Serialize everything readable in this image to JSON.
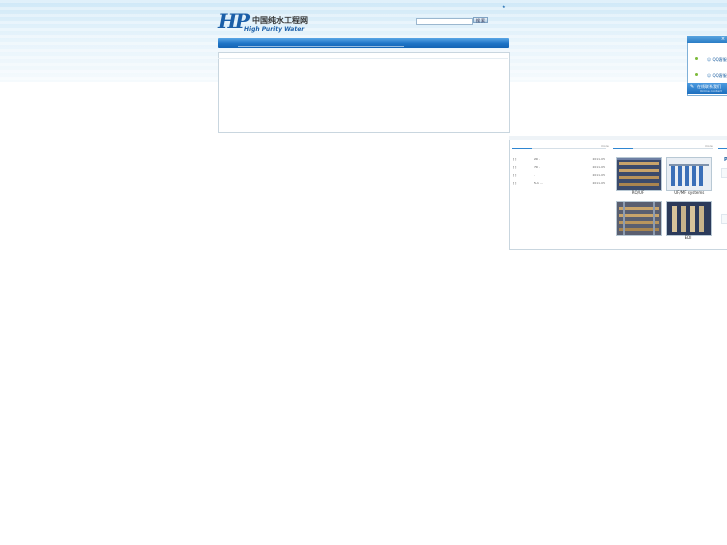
{
  "header": {
    "logo_mark": "HP",
    "logo_cn": "中国纯水工程网",
    "logo_en": "High Purity Water",
    "search": {
      "placeholder": "",
      "button_label": "搜 索"
    },
    "tiny_mark": "★"
  },
  "news": {
    "more_label": "more",
    "items": [
      {
        "bracket": "[  ]",
        "title": "20 .",
        "date": "2011-05"
      },
      {
        "bracket": "[  ]",
        "title": "70 .",
        "date": "2011-05"
      },
      {
        "bracket": "[  ]",
        "title": ".",
        "date": "2011-05"
      },
      {
        "bracket": "[  ]",
        "title": "5-1 ...",
        "date": "2011-05"
      }
    ]
  },
  "products": {
    "more_label": "more",
    "items": [
      {
        "caption": "RO/UF"
      },
      {
        "caption": "  UF/MF systems"
      },
      {
        "caption": ""
      },
      {
        "caption": "EDI"
      }
    ]
  },
  "side_fragment": {
    "letter": "P"
  },
  "float_widget": {
    "close": "×",
    "qq_items": [
      {
        "label": "QQ客服"
      },
      {
        "label": "QQ客服"
      }
    ],
    "footer_label": "在线联系我们",
    "footer_sub": "Online contact"
  },
  "colors": {
    "nav_blue": "#1e74c6",
    "accent_blue": "#2f86d1",
    "status_green": "#7cba3a"
  }
}
